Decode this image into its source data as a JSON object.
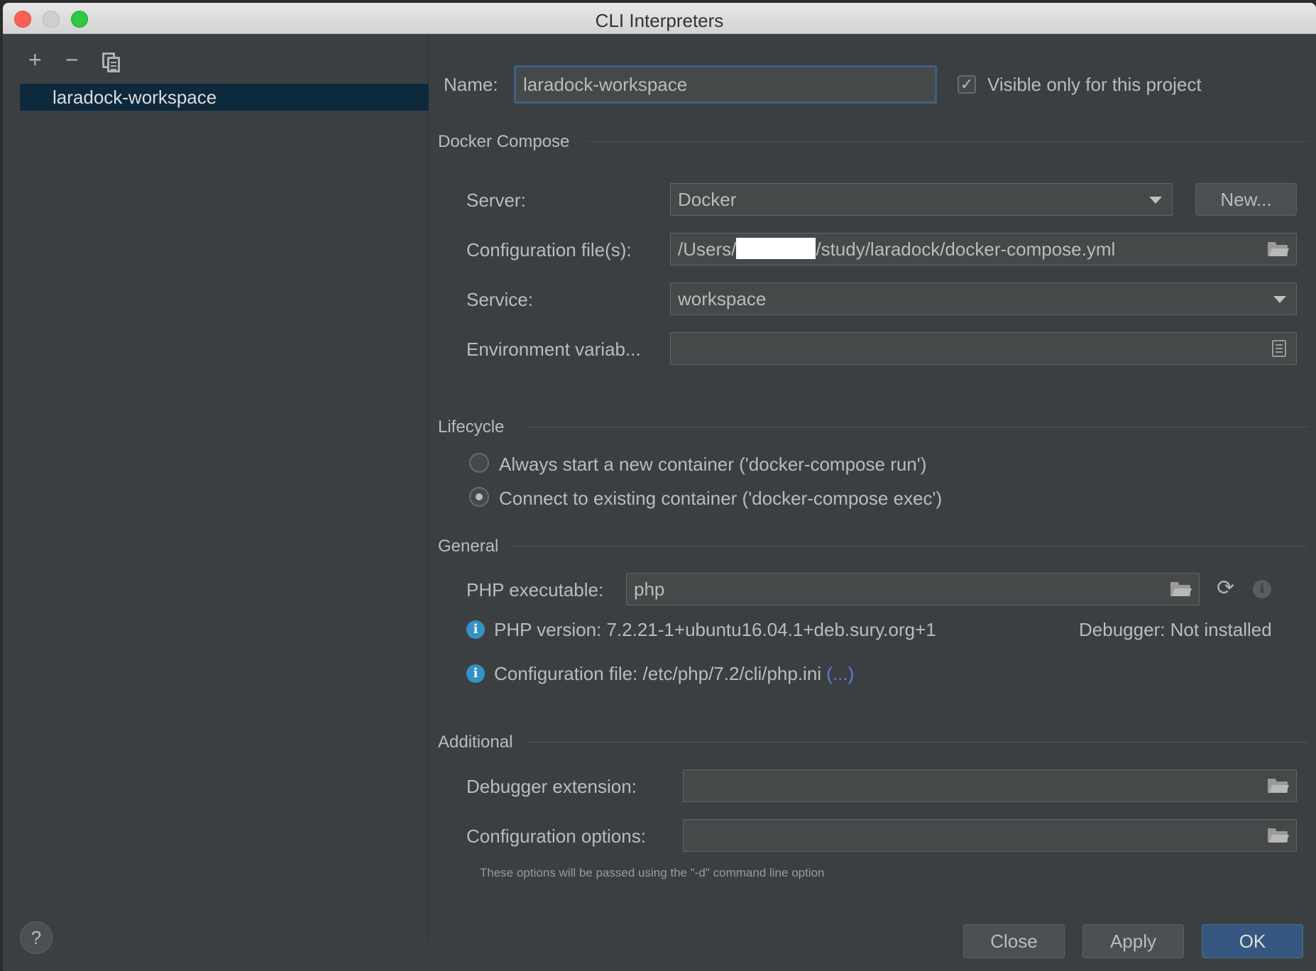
{
  "window": {
    "title": "CLI Interpreters"
  },
  "left": {
    "toolbar": {
      "add_glyph": "+",
      "remove_glyph": "−"
    },
    "interpreters": [
      "laradock-workspace"
    ]
  },
  "name_row": {
    "label": "Name:",
    "value": "laradock-workspace",
    "visible_checkbox_label": "Visible only for this project",
    "visible_checked": true
  },
  "docker_compose": {
    "title": "Docker Compose",
    "server_label": "Server:",
    "server_value": "Docker",
    "new_button": "New...",
    "config_label": "Configuration file(s):",
    "config_prefix": "/Users/",
    "config_suffix": "/study/laradock/docker-compose.yml",
    "service_label": "Service:",
    "service_value": "workspace",
    "env_label": "Environment variab...",
    "env_value": ""
  },
  "lifecycle": {
    "title": "Lifecycle",
    "options": [
      {
        "label": "Always start a new container ('docker-compose run')",
        "checked": false
      },
      {
        "label": "Connect to existing container ('docker-compose exec')",
        "checked": true
      }
    ]
  },
  "general": {
    "title": "General",
    "php_label": "PHP executable:",
    "php_value": "php",
    "php_version": "PHP version: 7.2.21-1+ubuntu16.04.1+deb.sury.org+1",
    "debugger": "Debugger: Not installed",
    "config_file": "Configuration file: /etc/php/7.2/cli/php.ini",
    "config_link": "(...)"
  },
  "additional": {
    "title": "Additional",
    "debugger_ext_label": "Debugger extension:",
    "debugger_ext_value": "",
    "config_options_label": "Configuration options:",
    "config_options_value": "",
    "hint": "These options will be passed using the \"-d\" command line option"
  },
  "footer": {
    "help": "?",
    "close": "Close",
    "apply": "Apply",
    "ok": "OK"
  },
  "colors": {
    "background": "#3c3f41",
    "selection": "#0d293e",
    "primary_button": "#365880",
    "info_blue": "#3592c4",
    "link": "#5c7bd6"
  }
}
